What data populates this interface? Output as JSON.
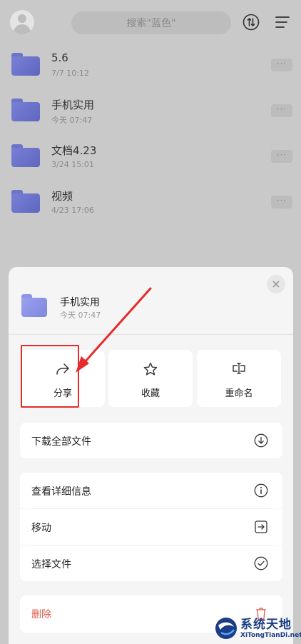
{
  "header": {
    "search_placeholder": "搜索\"蓝色\""
  },
  "files": [
    {
      "name": "5.6",
      "date": "7/7 10:12"
    },
    {
      "name": "手机实用",
      "date": "今天 07:47"
    },
    {
      "name": "文档4.23",
      "date": "3/24 15:01"
    },
    {
      "name": "视频",
      "date": "4/23 17:06"
    }
  ],
  "more_label": "···",
  "sheet": {
    "close_label": "×",
    "folder_name": "手机实用",
    "folder_date": "今天 07:47",
    "actions": [
      {
        "label": "分享",
        "icon": "share-icon"
      },
      {
        "label": "收藏",
        "icon": "star-icon"
      },
      {
        "label": "重命名",
        "icon": "rename-icon"
      }
    ],
    "options": [
      {
        "label": "下载全部文件",
        "icon": "download-icon"
      },
      {
        "label": "查看详细信息",
        "icon": "info-icon"
      },
      {
        "label": "移动",
        "icon": "move-icon"
      },
      {
        "label": "选择文件",
        "icon": "select-check-icon"
      },
      {
        "label": "删除",
        "icon": "trash-icon"
      }
    ]
  },
  "watermark": {
    "title": "系统天地",
    "subtitle": "XiTongTianDi.net"
  },
  "colors": {
    "accent_folder": "#6d74c8",
    "annotation_red": "#e52b2b",
    "delete_red": "#e05a4a"
  }
}
